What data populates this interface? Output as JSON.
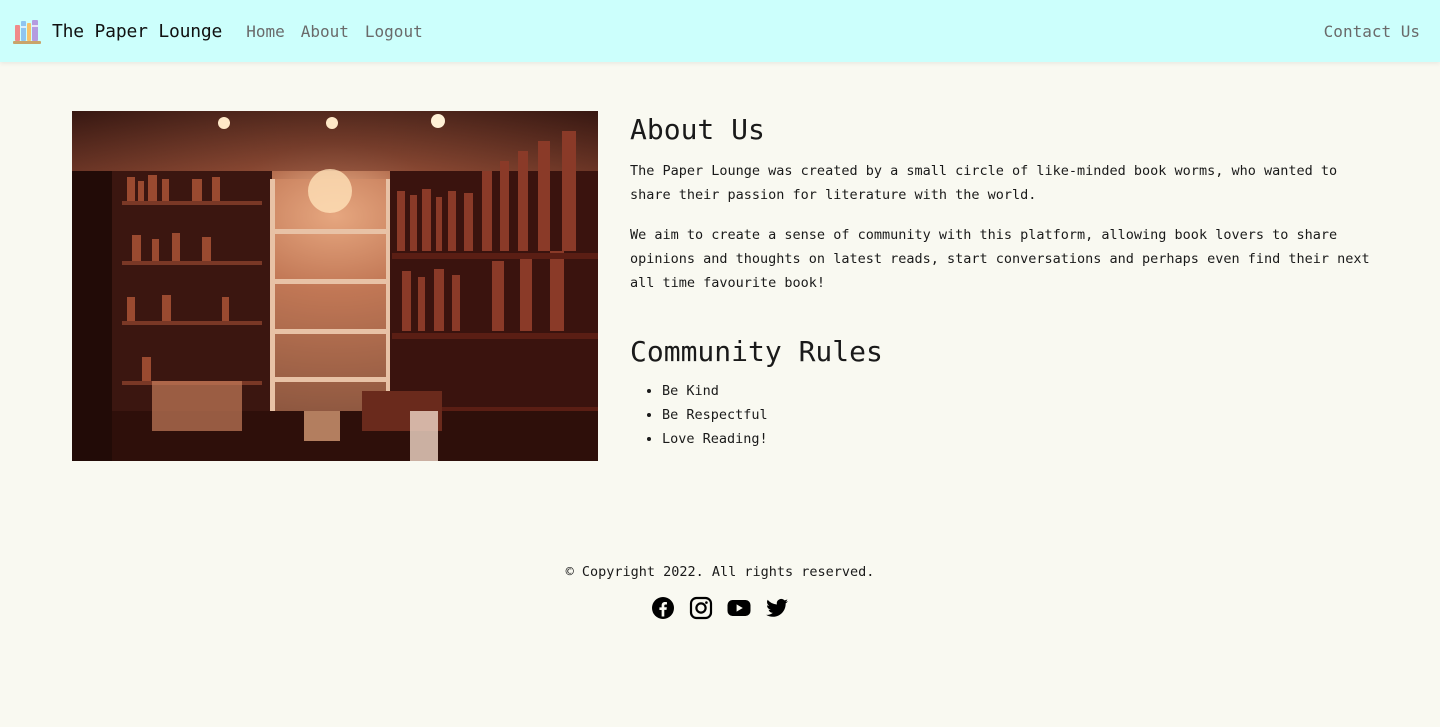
{
  "navbar": {
    "brand": {
      "name": "The Paper Lounge",
      "logo_icon": "books-icon"
    },
    "links": [
      {
        "label": "Home"
      },
      {
        "label": "About"
      },
      {
        "label": "Logout"
      }
    ],
    "contact_label": "Contact Us",
    "background": "#ccfffc"
  },
  "hero_image": {
    "icon": "bookshop-photo"
  },
  "about": {
    "title": "About Us",
    "paragraphs": [
      "The Paper Lounge was created by a small circle of like-minded book worms, who wanted to share their passion for literature with the world.",
      "We aim to create a sense of community with this platform, allowing book lovers to share opinions and thoughts on latest reads, start conversations and perhaps even find their next all time favourite book!"
    ]
  },
  "rules": {
    "title": "Community Rules",
    "items": [
      "Be Kind",
      "Be Respectful",
      "Love Reading!"
    ]
  },
  "footer": {
    "copyright": "© Copyright 2022. All rights reserved.",
    "socials": [
      {
        "icon": "facebook-icon"
      },
      {
        "icon": "instagram-icon"
      },
      {
        "icon": "youtube-icon"
      },
      {
        "icon": "twitter-icon"
      }
    ]
  },
  "colors": {
    "page_background": "#f9f9f1",
    "nav_link": "#6a6a6a",
    "text": "#1a1a1a"
  }
}
